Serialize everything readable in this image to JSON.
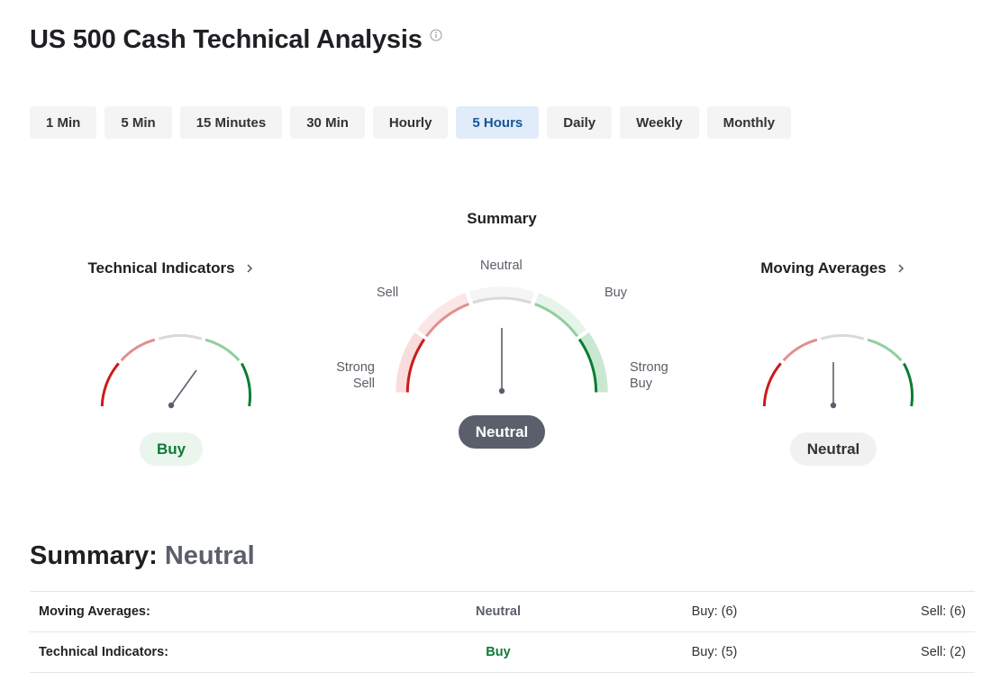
{
  "title": "US 500 Cash Technical Analysis",
  "tabs": [
    {
      "label": "1 Min",
      "active": false
    },
    {
      "label": "5 Min",
      "active": false
    },
    {
      "label": "15 Minutes",
      "active": false
    },
    {
      "label": "30 Min",
      "active": false
    },
    {
      "label": "Hourly",
      "active": false
    },
    {
      "label": "5 Hours",
      "active": true
    },
    {
      "label": "Daily",
      "active": false
    },
    {
      "label": "Weekly",
      "active": false
    },
    {
      "label": "Monthly",
      "active": false
    }
  ],
  "gauges": {
    "technical": {
      "heading": "Technical Indicators",
      "verdict": "Buy"
    },
    "summary": {
      "heading": "Summary",
      "verdict": "Neutral",
      "labels": {
        "neutral": "Neutral",
        "sell": "Sell",
        "buy": "Buy",
        "strong_sell": [
          "Strong",
          "Sell"
        ],
        "strong_buy": [
          "Strong",
          "Buy"
        ]
      }
    },
    "moving": {
      "heading": "Moving Averages",
      "verdict": "Neutral"
    }
  },
  "summary": {
    "label": "Summary:",
    "value": "Neutral",
    "rows": [
      {
        "label": "Moving Averages:",
        "verdict": "Neutral",
        "buy": "Buy: (6)",
        "sell": "Sell: (6)"
      },
      {
        "label": "Technical Indicators:",
        "verdict": "Buy",
        "buy": "Buy: (5)",
        "sell": "Sell: (2)"
      }
    ]
  },
  "colors": {
    "strong_sell": "#cc1b1b",
    "sell": "#e0908e",
    "neutral": "#d9d9d9",
    "buy": "#90ce9f",
    "strong_buy": "#0b7d32",
    "active_tab_bg": "#e0ecf9",
    "active_tab_text": "#1a5498"
  }
}
